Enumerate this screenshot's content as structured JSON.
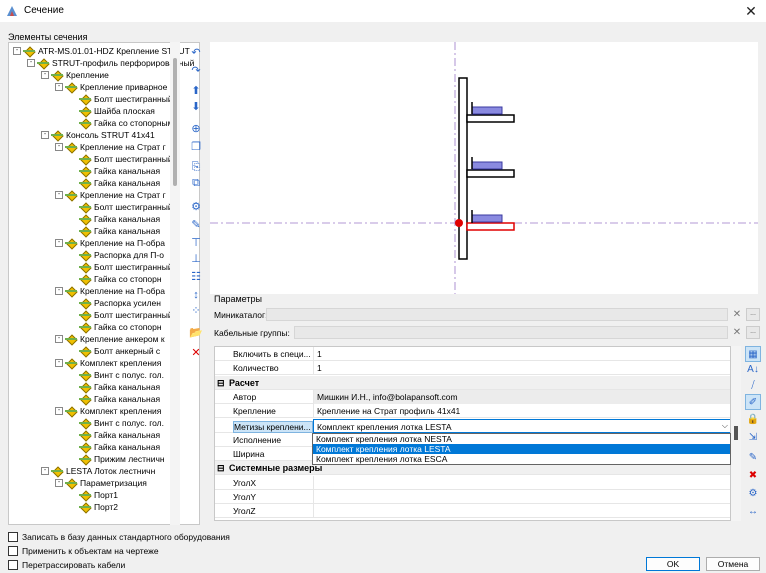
{
  "window": {
    "title": "Сечение"
  },
  "tree": {
    "label": "Элементы сечения",
    "items": [
      {
        "text": "ATR-MS.01.01-HDZ Крепление STRUT",
        "level": 0,
        "expander": "-"
      },
      {
        "text": "STRUT-профиль перфорированный",
        "level": 1,
        "expander": "-"
      },
      {
        "text": "Крепление",
        "level": 2,
        "expander": "-"
      },
      {
        "text": "Крепление приварное",
        "level": 3,
        "expander": "-"
      },
      {
        "text": "Болт шестигранный",
        "level": 4,
        "expander": ""
      },
      {
        "text": "Шайба плоская",
        "level": 4,
        "expander": ""
      },
      {
        "text": "Гайка со стопорным",
        "level": 4,
        "expander": ""
      },
      {
        "text": "Консоль STRUT 41x41",
        "level": 2,
        "expander": "-"
      },
      {
        "text": "Крепление на Страт г",
        "level": 3,
        "expander": "-"
      },
      {
        "text": "Болт шестигранный",
        "level": 4,
        "expander": ""
      },
      {
        "text": "Гайка канальная",
        "level": 4,
        "expander": ""
      },
      {
        "text": "Гайка канальная",
        "level": 4,
        "expander": ""
      },
      {
        "text": "Крепление на Страт г",
        "level": 3,
        "expander": "-"
      },
      {
        "text": "Болт шестигранный",
        "level": 4,
        "expander": ""
      },
      {
        "text": "Гайка канальная",
        "level": 4,
        "expander": ""
      },
      {
        "text": "Гайка канальная",
        "level": 4,
        "expander": ""
      },
      {
        "text": "Крепление на П-обра",
        "level": 3,
        "expander": "-"
      },
      {
        "text": "Распорка для П-о",
        "level": 4,
        "expander": ""
      },
      {
        "text": "Болт шестигранный",
        "level": 4,
        "expander": ""
      },
      {
        "text": "Гайка со стопорн",
        "level": 4,
        "expander": ""
      },
      {
        "text": "Крепление на П-обра",
        "level": 3,
        "expander": "-"
      },
      {
        "text": "Распорка усилен",
        "level": 4,
        "expander": ""
      },
      {
        "text": "Болт шестигранный",
        "level": 4,
        "expander": ""
      },
      {
        "text": "Гайка со стопорн",
        "level": 4,
        "expander": ""
      },
      {
        "text": "Крепление анкером к",
        "level": 3,
        "expander": "-"
      },
      {
        "text": "Болт анкерный с",
        "level": 4,
        "expander": ""
      },
      {
        "text": "Комплект крепления",
        "level": 3,
        "expander": "-"
      },
      {
        "text": "Винт с полус. гол.",
        "level": 4,
        "expander": ""
      },
      {
        "text": "Гайка канальная",
        "level": 4,
        "expander": ""
      },
      {
        "text": "Гайка канальная",
        "level": 4,
        "expander": ""
      },
      {
        "text": "Комплект крепления",
        "level": 3,
        "expander": "-"
      },
      {
        "text": "Винт с полус. гол.",
        "level": 4,
        "expander": ""
      },
      {
        "text": "Гайка канальная",
        "level": 4,
        "expander": ""
      },
      {
        "text": "Гайка канальная",
        "level": 4,
        "expander": ""
      },
      {
        "text": "Прижим лестничн",
        "level": 4,
        "expander": ""
      },
      {
        "text": "LESTA Лоток лестничн",
        "level": 2,
        "expander": "-"
      },
      {
        "text": "Параметризация",
        "level": 3,
        "expander": "-"
      },
      {
        "text": "Порт1",
        "level": 4,
        "expander": ""
      },
      {
        "text": "Порт2",
        "level": 4,
        "expander": ""
      }
    ]
  },
  "left_toolbar": {
    "icons": [
      "undo-icon",
      "redo-icon",
      "move-up-icon",
      "move-down-icon",
      "add-element-icon",
      "copy-icon",
      "paste-icon",
      "duplicate-icon",
      "add-bolt-icon",
      "edit-icon",
      "align-icon",
      "distribute-icon",
      "layout-icon",
      "dimension-icon",
      "group-icon",
      "open-folder-icon",
      "delete-icon"
    ],
    "glyphs": [
      "↶",
      "↷",
      "⬆",
      "⬇",
      "⊕",
      "❐",
      "⎘",
      "⧉",
      "⚙",
      "✎",
      "⊤",
      "⊥",
      "☷",
      "↕",
      "⁘",
      "📂",
      "✕"
    ]
  },
  "params": {
    "title": "Параметры",
    "minicatalog_label": "Миникаталог:",
    "cable_groups_label": "Кабельные группы:",
    "clear_glyph": "✕",
    "browse_glyph": "...",
    "rows": [
      {
        "type": "prop",
        "key": "Включить в специ...",
        "value": "1"
      },
      {
        "type": "prop",
        "key": "Количество",
        "value": "1"
      },
      {
        "type": "cat",
        "key": "Расчет",
        "toggle": "⊟"
      },
      {
        "type": "prop",
        "key": "Автор",
        "value": "Мишкин И.Н., info@bolapansoft.com",
        "shaded": true
      },
      {
        "type": "prop",
        "key": "Крепление",
        "value": "Крепление на Страт профиль 41x41"
      },
      {
        "type": "combo",
        "key": "Метизы креплени...",
        "value": "Комплект крепления лотка LESTA"
      },
      {
        "type": "prop",
        "key": "Исполнение",
        "value": ""
      },
      {
        "type": "prop",
        "key": "Ширина",
        "value": ""
      },
      {
        "type": "cat",
        "key": "Системные размеры",
        "toggle": "⊟"
      },
      {
        "type": "prop",
        "key": "УголX",
        "value": ""
      },
      {
        "type": "prop",
        "key": "УголY",
        "value": ""
      },
      {
        "type": "prop",
        "key": "УголZ",
        "value": ""
      }
    ],
    "dropdown_options": [
      "Комплект крепления лотка NESTA",
      "Комплект крепления лотка LESTA",
      "Комплект крепления лотка ESCA"
    ],
    "dropdown_selected": 1,
    "combo_arrow": "⌵"
  },
  "right_toolbar": {
    "icons": [
      "categorized-icon",
      "sort-az-icon",
      "filter-icon",
      "pin-icon",
      "lock-icon",
      "export-icon",
      "edit-field-icon",
      "remove-icon",
      "settings-icon",
      "auto-size-icon"
    ],
    "glyphs": [
      "▦",
      "A↓",
      "⧸",
      "✐",
      "🔒",
      "⇲",
      "✎",
      "✖",
      "⚙",
      "↔"
    ]
  },
  "checks": [
    {
      "label": "Записать в базу данных стандартного оборудования",
      "checked": false
    },
    {
      "label": "Применить к объектам на чертеже",
      "checked": false
    },
    {
      "label": "Перетрассировать кабели",
      "checked": false
    }
  ],
  "buttons": {
    "ok": "OK",
    "cancel": "Отмена"
  },
  "colors": {
    "accent": "#0078d7",
    "selection_red": "#e00000",
    "tray_blue": "#7070d0",
    "axis_line": "#9a78c8"
  }
}
